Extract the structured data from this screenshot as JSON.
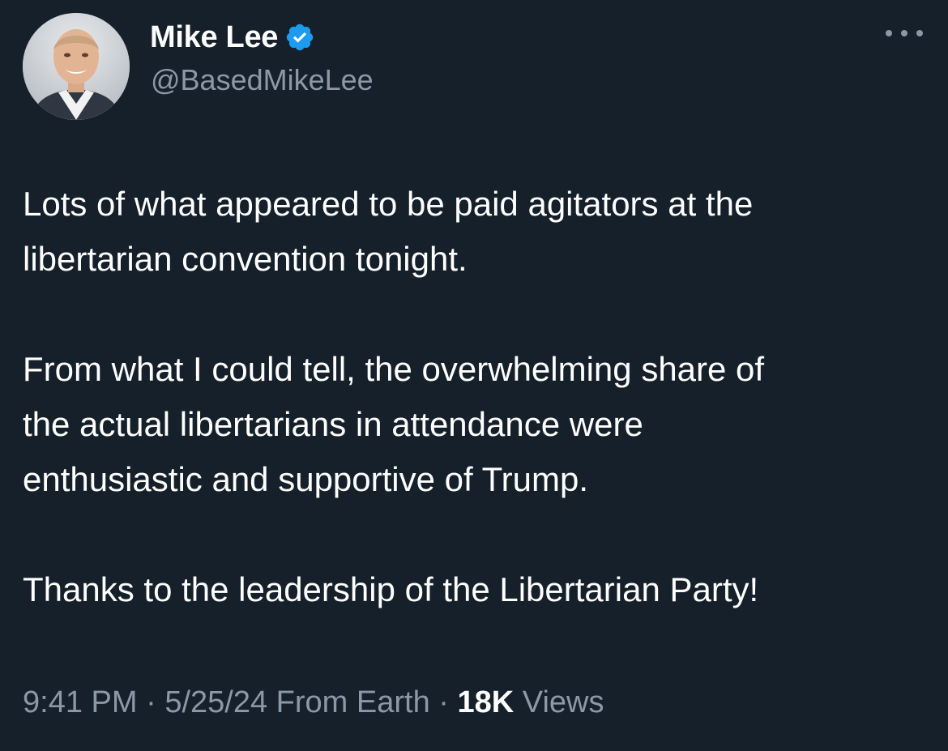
{
  "author": {
    "display_name": "Mike Lee",
    "handle": "@BasedMikeLee",
    "verified": true,
    "verified_color": "#1d9bf0"
  },
  "tweet": {
    "paragraphs": [
      {
        "lines": [
          "Lots of what appeared to be paid agitators at the",
          "libertarian convention tonight."
        ]
      },
      {
        "lines": [
          "From what I could tell, the overwhelming share of",
          "the actual libertarians in attendance were",
          "enthusiastic and supportive of Trump."
        ]
      },
      {
        "lines": [
          "Thanks to the leadership of the Libertarian Party!"
        ]
      }
    ]
  },
  "meta": {
    "time": "9:41 PM",
    "separator": "·",
    "date": "5/25/24",
    "source": "From Earth",
    "views_count": "18K",
    "views_label": "Views"
  },
  "icons": {
    "verified": "verified-badge-icon",
    "more": "more-horizontal-icon"
  },
  "colors": {
    "background": "#15202b",
    "text_primary": "#ffffff",
    "text_secondary": "#8b98a5"
  }
}
